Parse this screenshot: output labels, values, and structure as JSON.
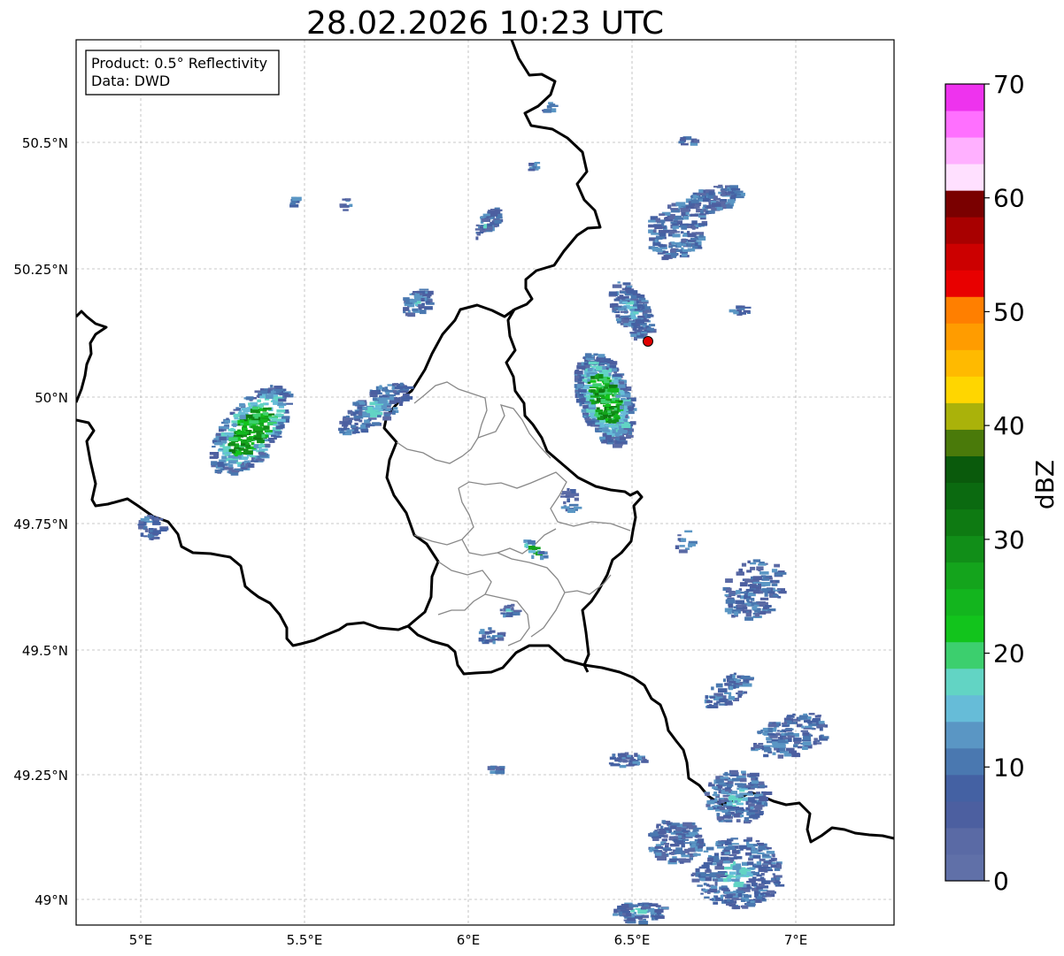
{
  "title": "28.02.2026 10:23 UTC",
  "info_box": {
    "product": "Product: 0.5° Reflectivity",
    "source": "Data: DWD"
  },
  "map": {
    "lon_range": [
      4.8,
      7.3
    ],
    "lat_range": [
      48.95,
      50.7
    ],
    "x_ticks": [
      "5°E",
      "5.5°E",
      "6°E",
      "6.5°E",
      "7°E"
    ],
    "y_ticks": [
      "50.5°N",
      "50.25°N",
      "50°N",
      "49.75°N",
      "49.5°N",
      "49.25°N",
      "49°N"
    ],
    "grid": "dashed gray",
    "radar_site": {
      "lon": 6.55,
      "lat": 50.11,
      "color": "#e00000"
    }
  },
  "colorbar": {
    "label": "dBZ",
    "range": [
      0,
      70
    ],
    "tick_labels": [
      "0",
      "10",
      "20",
      "30",
      "40",
      "50",
      "60",
      "70"
    ],
    "colors": [
      "#6070a8",
      "#5a6aa5",
      "#4c5fa0",
      "#4461a3",
      "#4a78b0",
      "#5a96c4",
      "#66bcd8",
      "#62d4c4",
      "#3ccf6e",
      "#12c41c",
      "#13b51e",
      "#14a41c",
      "#118e18",
      "#0e7a12",
      "#0b6a10",
      "#0a5a0c",
      "#4a7a0a",
      "#aab20a",
      "#ffd600",
      "#ffba00",
      "#ff9c00",
      "#ff7f00",
      "#e80000",
      "#cc0000",
      "#a80000",
      "#7a0000",
      "#ffe0ff",
      "#ffb0ff",
      "#ff70ff",
      "#ee33ee"
    ]
  }
}
